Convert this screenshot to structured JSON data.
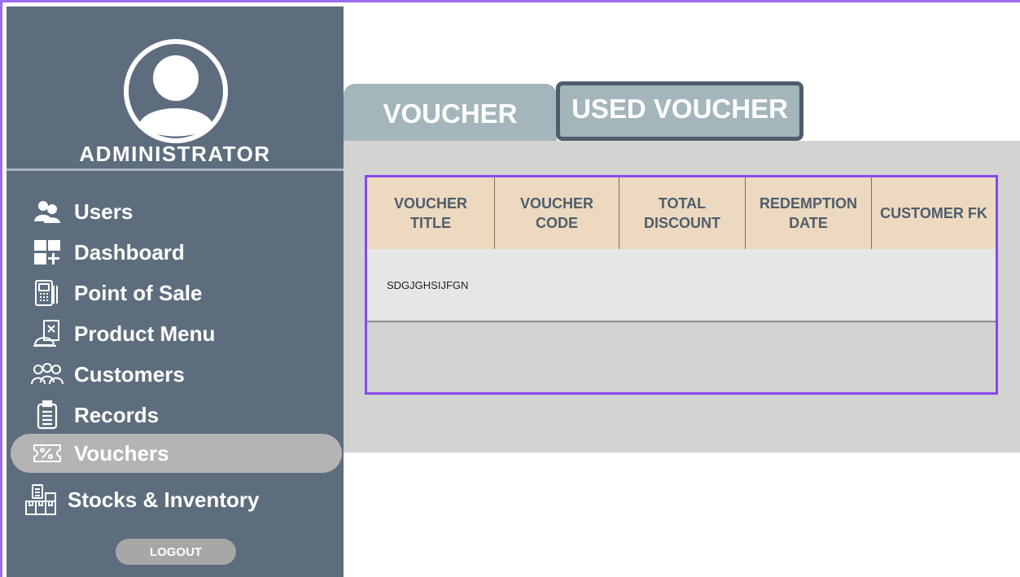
{
  "sidebar": {
    "role_title": "ADMINISTRATOR",
    "items": [
      {
        "label": "Users",
        "icon": "users-icon"
      },
      {
        "label": "Dashboard",
        "icon": "dashboard-icon"
      },
      {
        "label": "Point of Sale",
        "icon": "pos-terminal-icon"
      },
      {
        "label": "Product Menu",
        "icon": "product-menu-icon"
      },
      {
        "label": "Customers",
        "icon": "customers-icon"
      },
      {
        "label": "Records",
        "icon": "clipboard-icon"
      },
      {
        "label": "Vouchers",
        "icon": "voucher-icon",
        "active": true
      },
      {
        "label": "Stocks & Inventory",
        "icon": "inventory-boxes-icon"
      }
    ],
    "logout_label": "LOGOUT"
  },
  "tabs": [
    {
      "label": "VOUCHER"
    },
    {
      "label": "USED VOUCHER",
      "selected": true
    }
  ],
  "table": {
    "columns": [
      "VOUCHER TITLE",
      "VOUCHER CODE",
      "TOTAL DISCOUNT",
      "REDEMPTION DATE",
      "CUSTOMER FK"
    ],
    "rows": [
      [
        "SDGJGHSIJFGN",
        "",
        "",
        "",
        ""
      ]
    ]
  },
  "colors": {
    "sidebar_bg": "#5e6d7e",
    "active_item_bg": "#b4b4b4",
    "tab_bg": "#a4b5bc",
    "tab_selected_border": "#4d5d6e",
    "header_bg": "#ecd9bf",
    "header_text": "#4f5d6c",
    "table_border": "#8a47ee",
    "panel_bg": "#d3d3d1"
  }
}
